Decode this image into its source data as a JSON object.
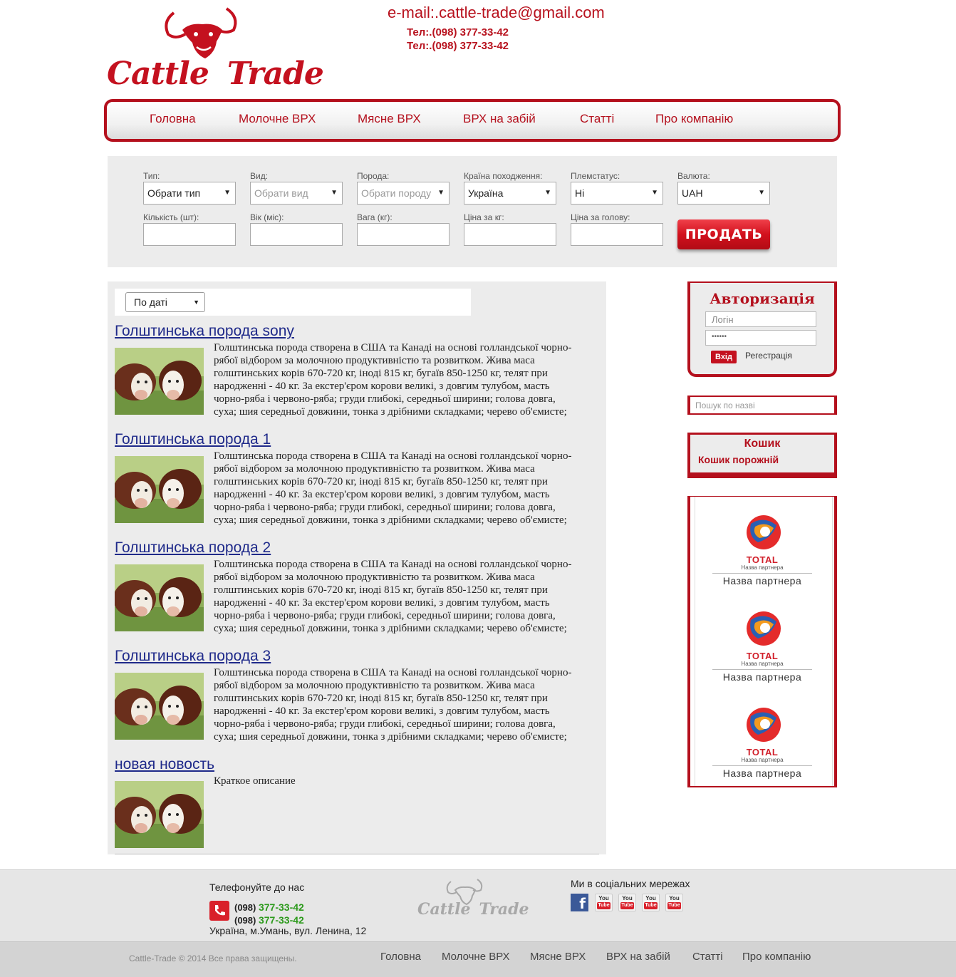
{
  "header": {
    "logo_alt": "Cattle Trade",
    "logo_part1": "Cattle",
    "logo_part2": "Trade",
    "email": "e-mail:.cattle-trade@gmail.com",
    "phones": [
      "Тел:.(098) 377-33-42",
      "Тел:.(098) 377-33-42"
    ]
  },
  "nav": [
    "Головна",
    "Молочне ВРХ",
    "Мясне ВРХ",
    "ВРХ на забій",
    "Статті",
    "Про компанію"
  ],
  "filters": {
    "row1": [
      {
        "label": "Тип:",
        "value": "Обрати тип",
        "placeholder": false
      },
      {
        "label": "Вид:",
        "value": "Обрати вид",
        "placeholder": true
      },
      {
        "label": "Порода:",
        "value": "Обрати породу",
        "placeholder": true
      },
      {
        "label": "Країна походження:",
        "value": "Україна",
        "placeholder": false
      },
      {
        "label": "Племстатус:",
        "value": "Ні",
        "placeholder": false
      },
      {
        "label": "Валюта:",
        "value": "UAH",
        "placeholder": false
      }
    ],
    "row2": [
      "Кількість (шт):",
      "Вік (міс):",
      "Вага (кг):",
      "Ціна за кг:",
      "Ціна за голову:"
    ],
    "sell_button": "ПРОДАТЬ"
  },
  "sort": {
    "value": "По даті"
  },
  "news": [
    {
      "title": "Голштинська порода sony",
      "text": "Голштинська порода створена в США та Канаді на основі голландської чорно-рябої відбором за молочною продуктивністю та розвитком. Жива маса голштинських корів 670-720 кг, іноді 815 кг, бугаїв 850-1250 кг, телят при народженні - 40 кг. За екстер'єром корови великі, з довгим тулубом, масть чорно-ряба і червоно-ряба; груди глибокі, середньої ширини; голова довга, суха; шия середньої довжини, тонка з дрібними складками; черево об'ємисте;"
    },
    {
      "title": "Голштинська порода 1",
      "text": "Голштинська порода створена в США та Канаді на основі голландської чорно-рябої відбором за молочною продуктивністю та розвитком. Жива маса голштинських корів 670-720 кг, іноді 815 кг, бугаїв 850-1250 кг, телят при народженні - 40 кг. За екстер'єром корови великі, з довгим тулубом, масть чорно-ряба і червоно-ряба; груди глибокі, середньої ширини; голова довга, суха; шия середньої довжини, тонка з дрібними складками; черево об'ємисте;"
    },
    {
      "title": "Голштинська порода 2",
      "text": "Голштинська порода створена в США та Канаді на основі голландської чорно-рябої відбором за молочною продуктивністю та розвитком. Жива маса голштинських корів 670-720 кг, іноді 815 кг, бугаїв 850-1250 кг, телят при народженні - 40 кг. За екстер'єром корови великі, з довгим тулубом, масть чорно-ряба і червоно-ряба; груди глибокі, середньої ширини; голова довга, суха; шия середньої довжини, тонка з дрібними складками; черево об'ємисте;"
    },
    {
      "title": "Голштинська порода 3",
      "text": "Голштинська порода створена в США та Канаді на основі голландської чорно-рябої відбором за молочною продуктивністю та розвитком. Жива маса голштинських корів 670-720 кг, іноді 815 кг, бугаїв 850-1250 кг, телят при народженні - 40 кг. За екстер'єром корови великі, з довгим тулубом, масть чорно-ряба і червоно-ряба; груди глибокі, середньої ширини; голова довга, суха; шия середньої довжини, тонка з дрібними складками; черево об'ємисте;"
    },
    {
      "title": "новая новость",
      "text": "Краткое описание"
    }
  ],
  "auth": {
    "title": "Авторизація",
    "login_placeholder": "Логін",
    "password_mask": "••••••",
    "login_button": "Вхід",
    "register": "Регестрація"
  },
  "search": {
    "placeholder": "Пошук по назві"
  },
  "cart": {
    "title": "Кошик",
    "empty": "Кошик порожній"
  },
  "partners": [
    {
      "brand": "TOTAL",
      "sub": "Назва партнера",
      "name": "Назва партнера"
    },
    {
      "brand": "TOTAL",
      "sub": "Назва партнера",
      "name": "Назва партнера"
    },
    {
      "brand": "TOTAL",
      "sub": "Назва партнера",
      "name": "Назва партнера"
    }
  ],
  "footer": {
    "call_us": "Телефонуйте до нас",
    "phones": [
      {
        "code": "(098)",
        "num": "377-33-42"
      },
      {
        "code": "(098)",
        "num": "377-33-42"
      }
    ],
    "address": "Україна, м.Умань, вул. Ленина, 12",
    "logo_part1": "Cattle",
    "logo_part2": "Trade",
    "social_title": "Ми в соціальних мережах",
    "social": [
      "facebook-icon",
      "youtube-icon",
      "youtube-icon",
      "youtube-icon",
      "youtube-icon"
    ],
    "youtube_you": "You",
    "youtube_tube": "Tube",
    "facebook_letter": "f"
  },
  "bottom": {
    "copyright": "Cattle-Trade © 2014 Все права защищены.",
    "nav": [
      "Головна",
      "Молочне ВРХ",
      "Мясне ВРХ",
      "ВРХ на забій",
      "Статті",
      "Про компанію"
    ]
  },
  "colors": {
    "brand": "#b4101d",
    "link": "#1f2a8a",
    "phone_green": "#2c9a1c"
  }
}
